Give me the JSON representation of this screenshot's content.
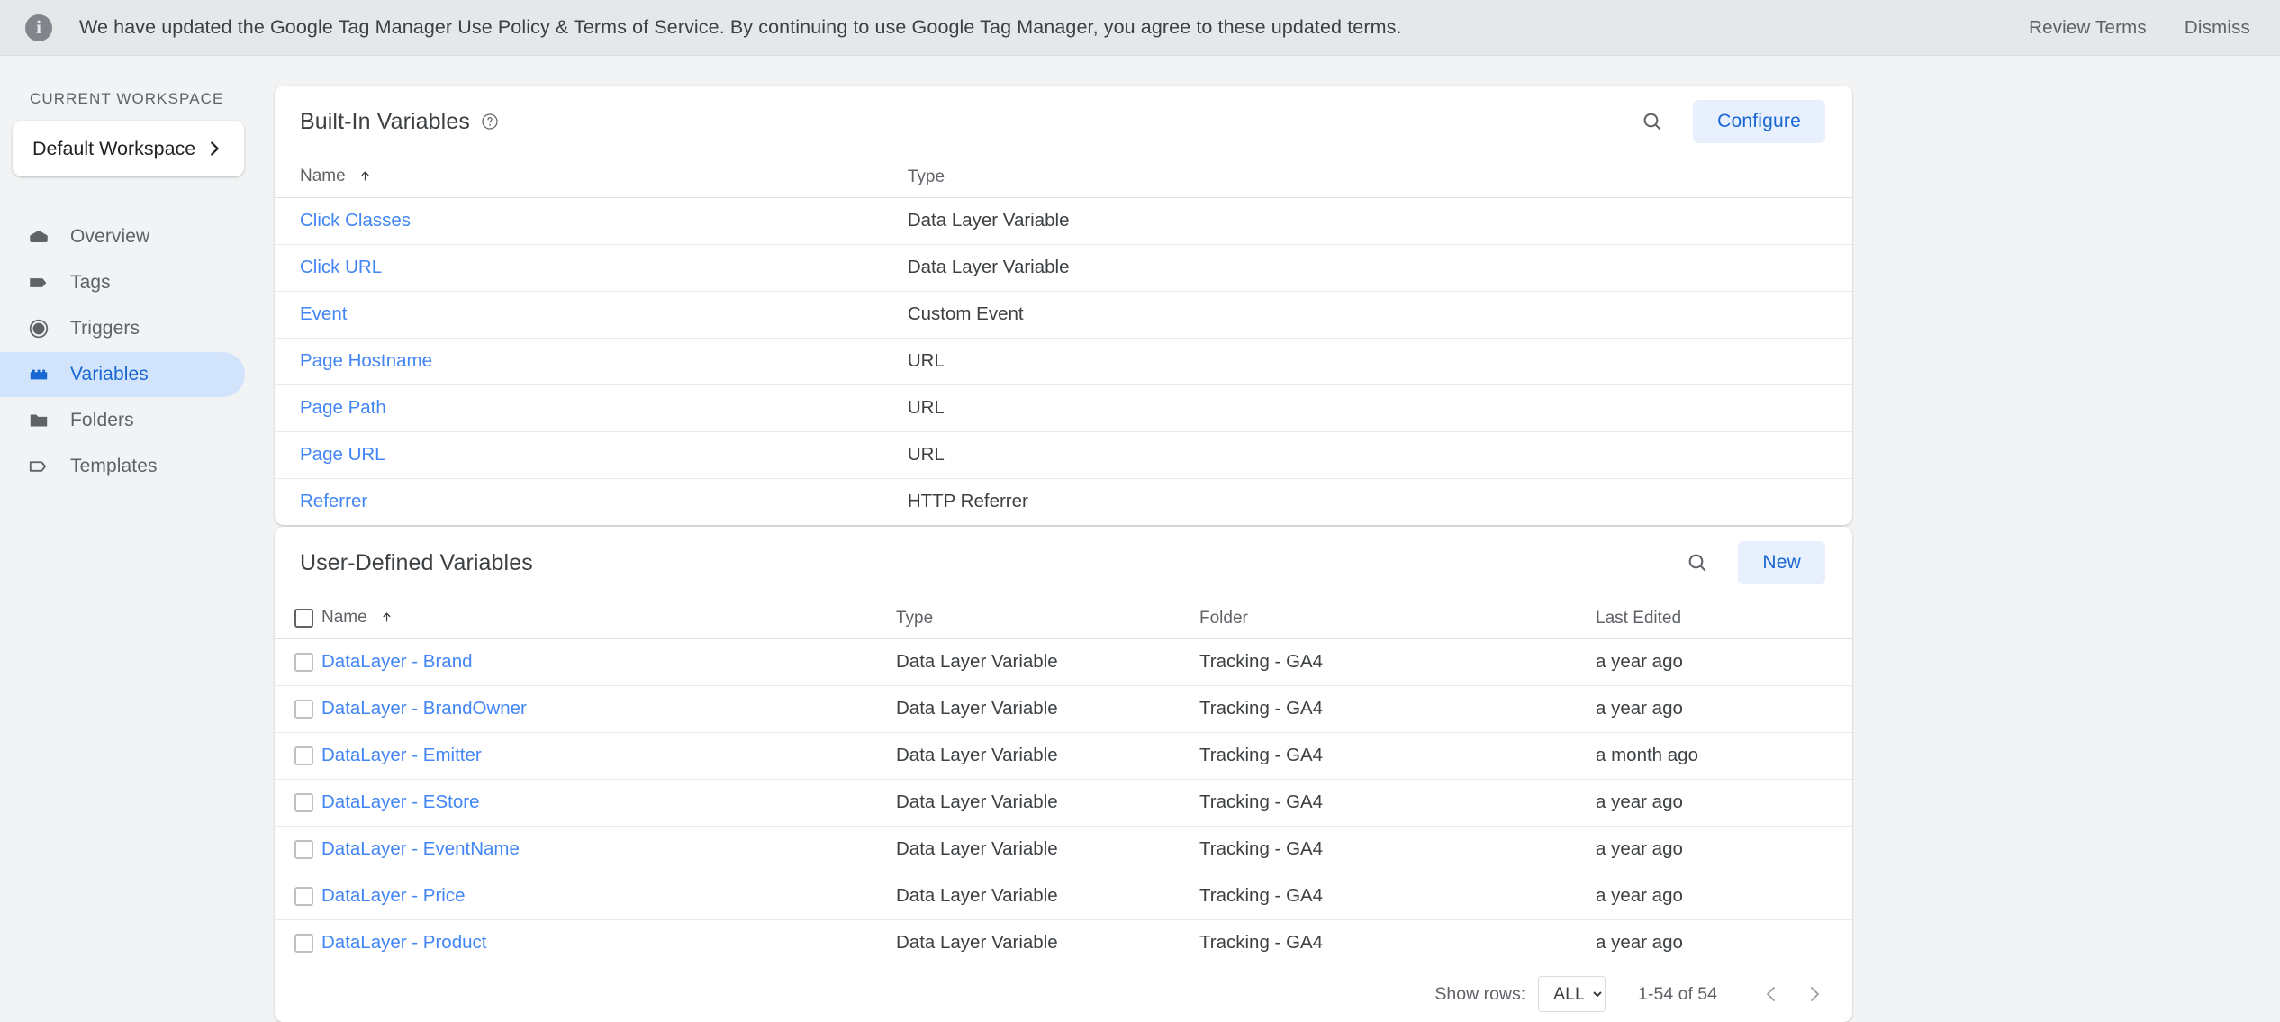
{
  "banner": {
    "icon": "info-icon",
    "message": "We have updated the Google Tag Manager Use Policy & Terms of Service. By continuing to use Google Tag Manager, you agree to these updated terms.",
    "review_label": "Review Terms",
    "dismiss_label": "Dismiss"
  },
  "sidebar": {
    "section_label": "CURRENT WORKSPACE",
    "workspace_name": "Default Workspace",
    "chevron": "chevron-right-icon",
    "items": [
      {
        "label": "Overview",
        "icon": "overview-icon",
        "active": false
      },
      {
        "label": "Tags",
        "icon": "tag-icon",
        "active": false
      },
      {
        "label": "Triggers",
        "icon": "trigger-icon",
        "active": false
      },
      {
        "label": "Variables",
        "icon": "variable-icon",
        "active": true
      },
      {
        "label": "Folders",
        "icon": "folder-icon",
        "active": false
      },
      {
        "label": "Templates",
        "icon": "template-icon",
        "active": false
      }
    ]
  },
  "builtin": {
    "title": "Built-In Variables",
    "help_icon": "help-icon",
    "search_icon": "search-icon",
    "configure_label": "Configure",
    "columns": {
      "name": "Name",
      "type": "Type"
    },
    "sort_arrow": "sort-ascending-icon",
    "rows": [
      {
        "name": "Click Classes",
        "type": "Data Layer Variable"
      },
      {
        "name": "Click URL",
        "type": "Data Layer Variable"
      },
      {
        "name": "Event",
        "type": "Custom Event"
      },
      {
        "name": "Page Hostname",
        "type": "URL"
      },
      {
        "name": "Page Path",
        "type": "URL"
      },
      {
        "name": "Page URL",
        "type": "URL"
      },
      {
        "name": "Referrer",
        "type": "HTTP Referrer"
      }
    ]
  },
  "userdefined": {
    "title": "User-Defined Variables",
    "search_icon": "search-icon",
    "new_label": "New",
    "columns": {
      "name": "Name",
      "type": "Type",
      "folder": "Folder",
      "edited": "Last Edited"
    },
    "sort_arrow": "sort-ascending-icon",
    "rows": [
      {
        "name": "DataLayer - Brand",
        "type": "Data Layer Variable",
        "folder": "Tracking - GA4",
        "edited": "a year ago"
      },
      {
        "name": "DataLayer - BrandOwner",
        "type": "Data Layer Variable",
        "folder": "Tracking - GA4",
        "edited": "a year ago"
      },
      {
        "name": "DataLayer - Emitter",
        "type": "Data Layer Variable",
        "folder": "Tracking - GA4",
        "edited": "a month ago"
      },
      {
        "name": "DataLayer - EStore",
        "type": "Data Layer Variable",
        "folder": "Tracking - GA4",
        "edited": "a year ago"
      },
      {
        "name": "DataLayer - EventName",
        "type": "Data Layer Variable",
        "folder": "Tracking - GA4",
        "edited": "a year ago"
      },
      {
        "name": "DataLayer - Price",
        "type": "Data Layer Variable",
        "folder": "Tracking - GA4",
        "edited": "a year ago"
      },
      {
        "name": "DataLayer - Product",
        "type": "Data Layer Variable",
        "folder": "Tracking - GA4",
        "edited": "a year ago"
      }
    ],
    "footer": {
      "show_rows_label": "Show rows:",
      "rows_value": "ALL",
      "rows_options": [
        "ALL"
      ],
      "range": "1-54 of 54",
      "prev_icon": "chevron-left-icon",
      "next_icon": "chevron-right-icon"
    }
  },
  "colors": {
    "accent_blue": "#1967d2",
    "link_blue": "#4285f4",
    "active_pill": "#d2e3fc",
    "button_bg": "#e8f0fe",
    "page_bg": "#f1f3f4",
    "banner_bg": "#e5e7e9"
  }
}
